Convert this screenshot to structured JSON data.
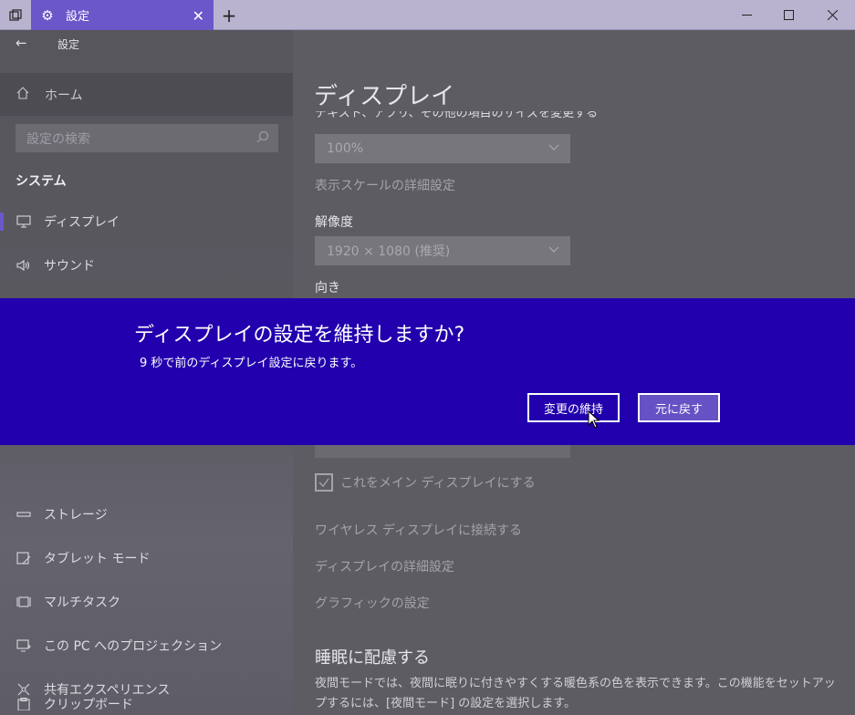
{
  "titlebar": {
    "tab_title": "設定",
    "close_tab": "✕",
    "new_tab": "+",
    "minimize": "—",
    "maximize": "☐",
    "close": "✕"
  },
  "sidebar": {
    "back": "←",
    "title": "設定",
    "home": "ホーム",
    "search_placeholder": "設定の検索",
    "section": "システム",
    "items": [
      {
        "label": "ディスプレイ",
        "icon": "monitor-icon",
        "active": true
      },
      {
        "label": "サウンド",
        "icon": "speaker-icon"
      },
      {
        "label": "ストレージ",
        "icon": "storage-icon"
      },
      {
        "label": "タブレット モード",
        "icon": "tablet-icon"
      },
      {
        "label": "マルチタスク",
        "icon": "multitask-icon"
      },
      {
        "label": "この PC へのプロジェクション",
        "icon": "projection-icon"
      },
      {
        "label": "共有エクスペリエンス",
        "icon": "share-icon"
      },
      {
        "label": "クリップボード",
        "icon": "clipboard-icon"
      }
    ]
  },
  "main": {
    "heading": "ディスプレイ",
    "scale_label_cut": "テキスト、アプリ、その他の項目のサイズを変更する",
    "scale_value": "100%",
    "scale_advanced": "表示スケールの詳細設定",
    "resolution_label": "解像度",
    "resolution_value": "1920 × 1080 (推奨)",
    "orientation_label": "向き",
    "main_display_checkbox": "これをメイン ディスプレイにする",
    "wireless_link": "ワイヤレス ディスプレイに接続する",
    "advanced_link": "ディスプレイの詳細設定",
    "graphics_link": "グラフィックの設定",
    "sleep_heading": "睡眠に配慮する",
    "sleep_text": "夜間モードでは、夜間に眠りに付きやすくする暖色系の色を表示できます。この機能をセットアップするには、[夜間モード] の設定を選択します。"
  },
  "dialog": {
    "title": "ディスプレイの設定を維持しますか?",
    "message": "9 秒で前のディスプレイ設定に戻ります。",
    "keep_button": "変更の維持",
    "revert_button": "元に戻す"
  },
  "colors": {
    "accent": "#6b57c9",
    "dialog_bg": "#2200ad"
  }
}
